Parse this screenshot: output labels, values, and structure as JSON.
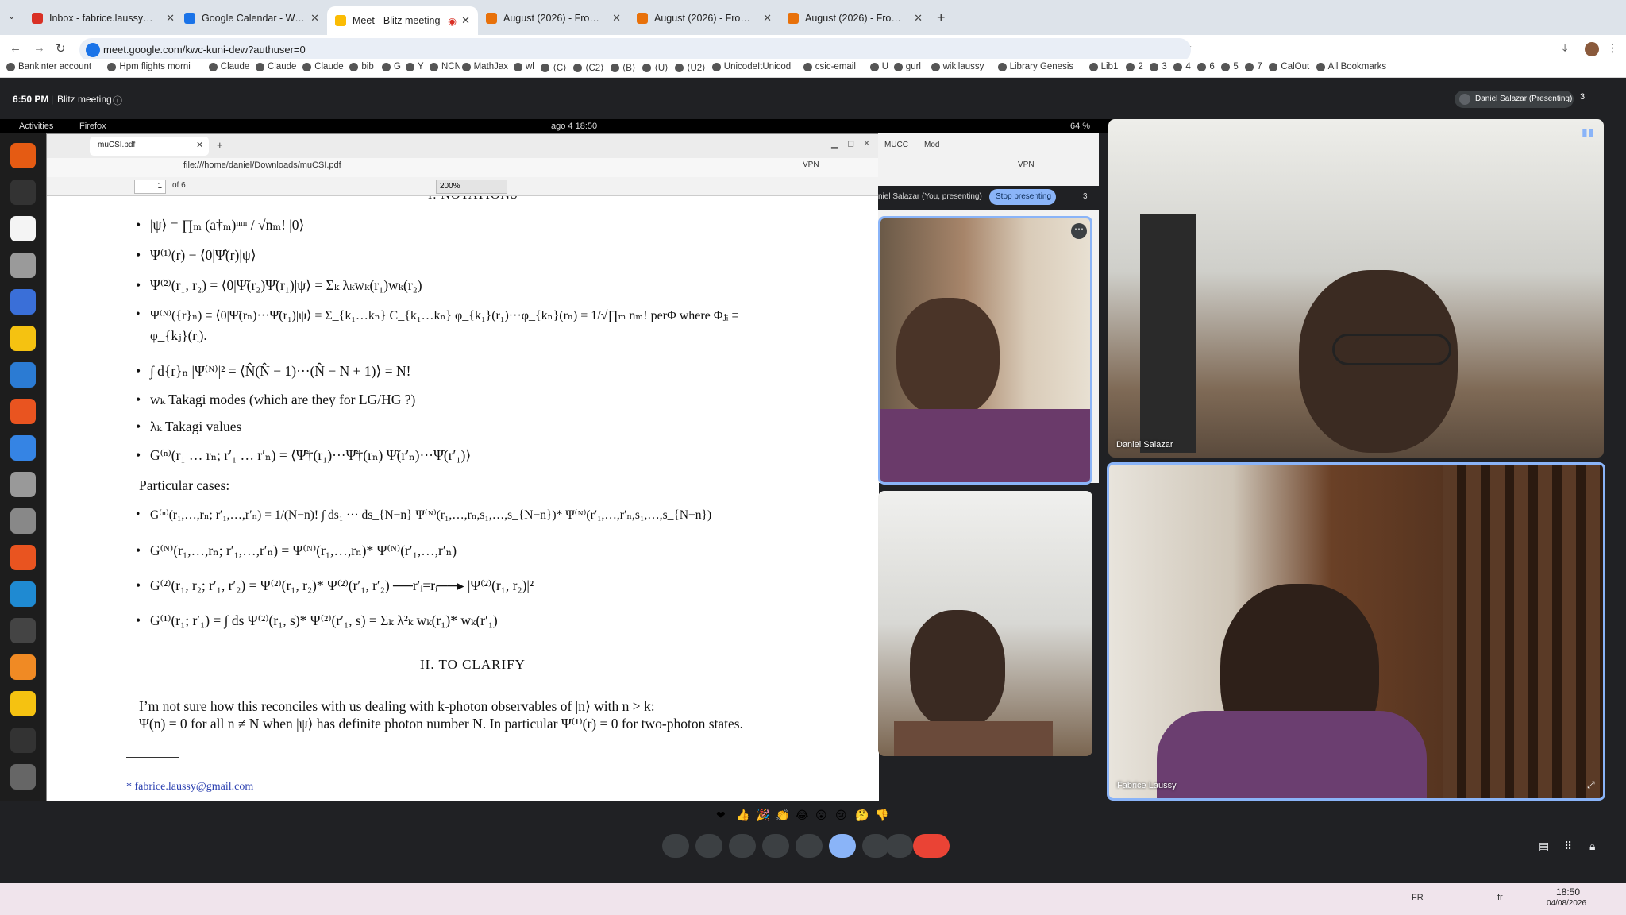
{
  "browser_tabs": [
    {
      "label": "Inbox - fabrice.laussy@gm",
      "color": "#d93025"
    },
    {
      "label": "Google Calendar - Week of",
      "color": "#1a73e8"
    },
    {
      "label": "Meet - Blitz meeting",
      "color": "#fbbc04"
    },
    {
      "label": "August (2026) - From th",
      "color": "#e8710a"
    },
    {
      "label": "August (2026) - From the w",
      "color": "#e8710a"
    },
    {
      "label": "August (2026) - From th",
      "color": "#e8710a"
    }
  ],
  "url": "meet.google.com/kwc-kuni-dew?authuser=0",
  "bookmarks": [
    "Bankinter account",
    "Hpm flights morni",
    "Claude",
    "Claude",
    "Claude",
    "bib",
    "G",
    "Y",
    "NCN",
    "MathJax",
    "wl",
    "⟨C⟩",
    "⟨C2⟩",
    "⟨B⟩",
    "⟨U⟩",
    "⟨U2⟩",
    "UnicodeItUnicod",
    "csic-email",
    "U",
    "gurl",
    "wikilaussy",
    "Library Genesis",
    "Lib1",
    "2",
    "3",
    "4",
    "6",
    "5",
    "7",
    "CalOut",
    "All Bookmarks"
  ],
  "meet_header": {
    "time": "6:50 PM",
    "name": "Blitz meeting",
    "presenter": "Daniel Salazar (Presenting)",
    "count": "3"
  },
  "gnome": {
    "activities": "Activities",
    "app": "Firefox",
    "clock": "ago 4  18:50",
    "battery": "64 %"
  },
  "firefox": {
    "tab": "muCSI.pdf",
    "url": "file:///home/daniel/Downloads/muCSI.pdf",
    "page": "1",
    "of": "of 6",
    "zoom": "200%",
    "vpn": "VPN"
  },
  "pdf": {
    "top_heading": "I.   NOTATIONS",
    "eq1": "|ψ⟩ = ∏ₘ (a†ₘ)ⁿᵐ / √nₘ! |0⟩",
    "eq2": "Ψ⁽¹⁾(r) ≡ ⟨0|Ψ̂(r)|ψ⟩",
    "eq3": "Ψ⁽²⁾(r₁, r₂) = ⟨0|Ψ̂(r₂)Ψ̂(r₁)|ψ⟩ = Σₖ λₖwₖ(r₁)wₖ(r₂)",
    "eq4a": "Ψ⁽ᴺ⁾({r}ₙ) ≡ ⟨0|Ψ̂(rₙ)···Ψ̂(r₁)|ψ⟩ = Σ_{k₁…kₙ} C_{k₁…kₙ} φ_{k₁}(r₁)···φ_{kₙ}(rₙ) = 1/√∏ₘ nₘ! perΦ where Φⱼᵢ ≡",
    "eq4b": "φ_{kⱼ}(rᵢ).",
    "eq5": "∫ d{r}ₙ |Ψ⁽ᴺ⁾|² = ⟨N̂(N̂ − 1)···(N̂ − N + 1)⟩ = N!",
    "eq6": "wₖ Takagi modes (which are they for LG/HG ?)",
    "eq7": "λₖ Takagi values",
    "eq8": "G⁽ⁿ⁾(r₁ … rₙ; r′₁ … r′ₙ) = ⟨Ψ̂†(r₁)···Ψ̂†(rₙ) Ψ̂(r′ₙ)···Ψ̂(r′₁)⟩",
    "particular": "Particular cases:",
    "eq9": "G⁽ⁿ⁾(r₁,…,rₙ; r′₁,…,r′ₙ) = 1/(N−n)! ∫ ds₁ ··· ds_{N−n} Ψ⁽ᴺ⁾(r₁,…,rₙ,s₁,…,s_{N−n})* Ψ⁽ᴺ⁾(r′₁,…,r′ₙ,s₁,…,s_{N−n})",
    "eq10": "G⁽ᴺ⁾(r₁,…,rₙ; r′₁,…,r′ₙ) = Ψ⁽ᴺ⁾(r₁,…,rₙ)* Ψ⁽ᴺ⁾(r′₁,…,r′ₙ)",
    "eq11": "G⁽²⁾(r₁, r₂; r′₁, r′₂) = Ψ⁽²⁾(r₁, r₂)* Ψ⁽²⁾(r′₁, r′₂)  ──r′ᵢ=rᵢ──▸  |Ψ⁽²⁾(r₁, r₂)|²",
    "eq12": "G⁽¹⁾(r₁; r′₁) = ∫ ds Ψ⁽²⁾(r₁, s)* Ψ⁽²⁾(r′₁, s) = Σₖ λ²ₖ wₖ(r₁)* wₖ(r′₁)",
    "section2": "II.   TO CLARIFY",
    "para1": "I’m not sure how this reconciles with us dealing with k-photon observables of |n⟩ with n > k:",
    "para2": "Ψ(n) = 0 for all n ≠ N when |ψ⟩ has definite photon number N. In particular Ψ⁽¹⁾(r) = 0 for two-photon states.",
    "footnote": "* fabrice.laussy@gmail.com"
  },
  "win2": {
    "tab1": "MUCC",
    "tab2": "Mod",
    "vpn": "VPN",
    "presenting": "niel Salazar (You, presenting)",
    "stop": "Stop presenting",
    "count": "3"
  },
  "participants": [
    {
      "name": "Daniel Salazar"
    },
    {
      "name": "Fabrice Laussy"
    }
  ],
  "reactions": [
    "❤",
    "👍",
    "🎉",
    "👏",
    "😂",
    "😮",
    "😢",
    "🤔",
    "👎"
  ],
  "taskbar": {
    "time": "18:50",
    "date": "04/08/2026",
    "lang": "FR",
    "kb": "fr"
  }
}
